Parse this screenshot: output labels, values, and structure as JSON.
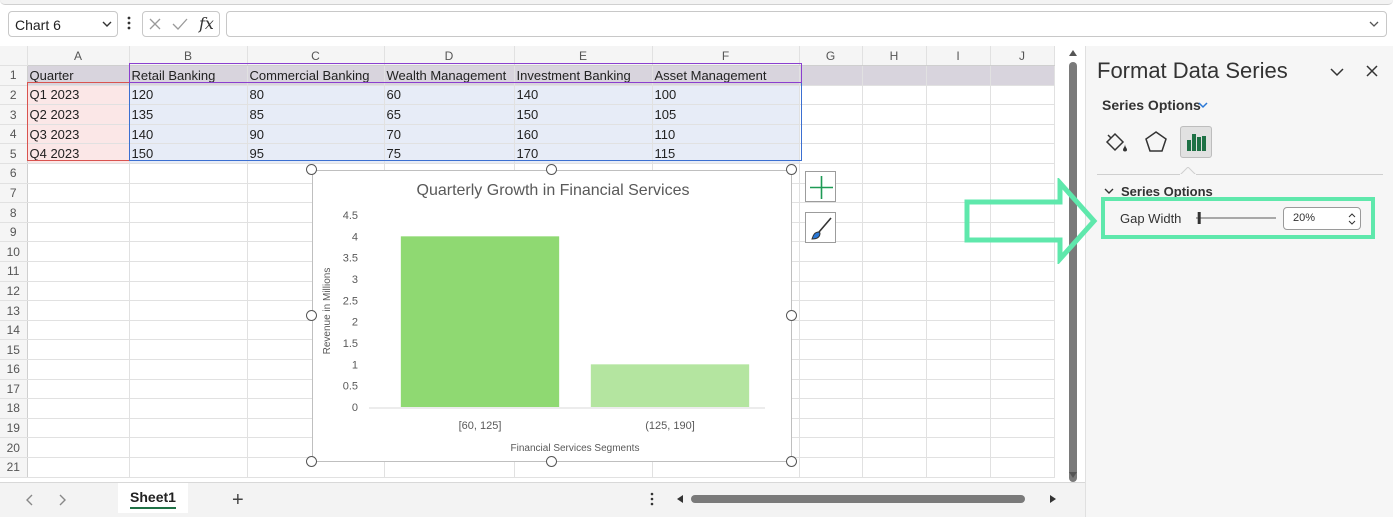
{
  "formula_bar": {
    "namebox": "Chart 6",
    "fx_label": "fx",
    "formula_value": ""
  },
  "sheet": {
    "columns": [
      "A",
      "B",
      "C",
      "D",
      "E",
      "F",
      "G",
      "H",
      "I",
      "J"
    ],
    "rows": [
      "1",
      "2",
      "3",
      "4",
      "5",
      "6",
      "7",
      "8",
      "9",
      "10",
      "11",
      "12",
      "13",
      "14",
      "15",
      "16",
      "17",
      "18",
      "19",
      "20",
      "21"
    ],
    "header": [
      "Quarter",
      "Retail Banking",
      "Commercial Banking",
      "Wealth Management",
      "Investment Banking",
      "Asset Management"
    ],
    "data": [
      [
        "Q1 2023",
        "120",
        "80",
        "60",
        "140",
        "100"
      ],
      [
        "Q2 2023",
        "135",
        "85",
        "65",
        "150",
        "105"
      ],
      [
        "Q3 2023",
        "140",
        "90",
        "70",
        "160",
        "110"
      ],
      [
        "Q4 2023",
        "150",
        "95",
        "75",
        "170",
        "115"
      ]
    ]
  },
  "chart_data": {
    "type": "bar",
    "title": "Quarterly Growth in Financial Services",
    "xlabel": "Financial Services Segments",
    "ylabel": "Revenue in Millions",
    "categories": [
      "[60, 125]",
      "(125, 190]"
    ],
    "values": [
      4,
      1
    ],
    "ylim": [
      0,
      4.5
    ],
    "yticks": [
      "0",
      "0.5",
      "1",
      "1.5",
      "2",
      "2.5",
      "3",
      "3.5",
      "4",
      "4.5"
    ],
    "gap_width_percent": 20,
    "colors": [
      "#8fd972",
      "#b4e5a0"
    ],
    "grid": false,
    "legend": "none"
  },
  "sheet_tabs": {
    "active": "Sheet1",
    "add_label": "+"
  },
  "pane": {
    "title": "Format Data Series",
    "dropdown": "Series Options",
    "section": "Series Options",
    "gap_width_label": "Gap Width",
    "gap_width_value": "20%",
    "gap_width_fraction": 0.2,
    "icons": [
      "fill-line-icon",
      "effects-pentagon-icon",
      "series-options-chart-icon"
    ]
  },
  "colors": {
    "accent_green": "#1e7145",
    "callout": "#5fe8ac",
    "selection_red": "#d9534f",
    "selection_blue": "#3b6fd1",
    "selection_purple": "#8a3fcf"
  }
}
